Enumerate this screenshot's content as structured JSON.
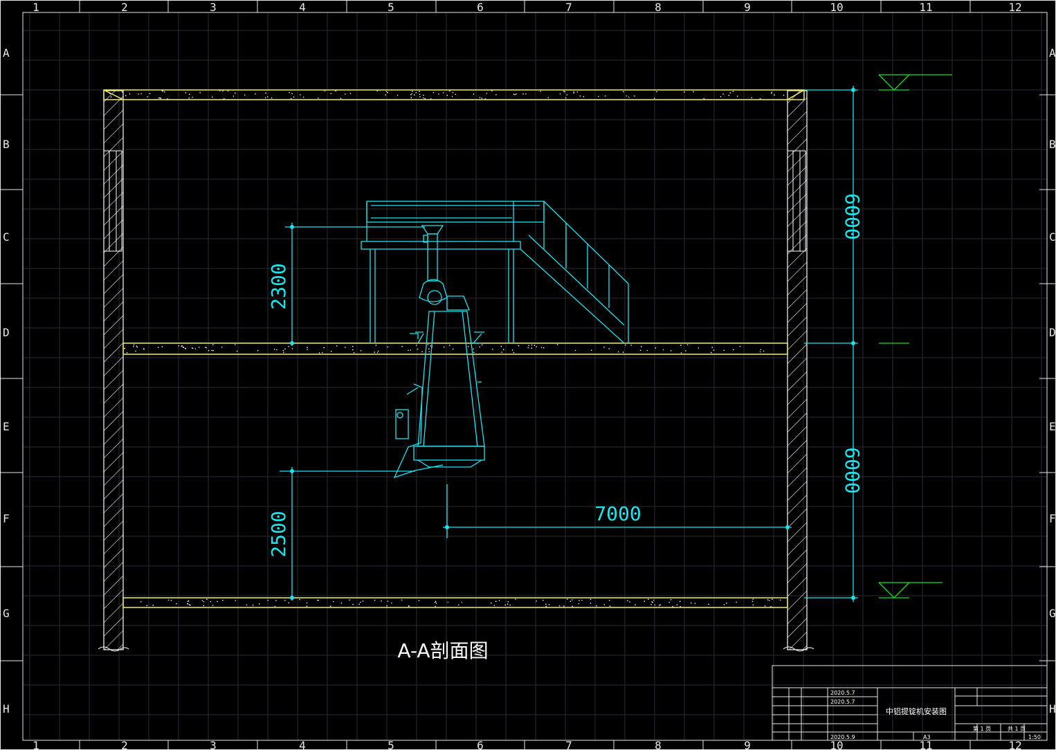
{
  "colors": {
    "background": "#000000",
    "grid": "#2b2b34",
    "frame": "#e8e8e8",
    "equipment": "#19e6ee",
    "slab": "#f5f05a",
    "level_marker": "#18e018"
  },
  "frame": {
    "column_labels": [
      "1",
      "2",
      "3",
      "4",
      "5",
      "6",
      "7",
      "8",
      "9",
      "10",
      "11",
      "12"
    ],
    "row_labels": [
      "A",
      "B",
      "C",
      "D",
      "E",
      "F",
      "G",
      "H"
    ]
  },
  "drawing": {
    "title": "A-A剖面图",
    "dimensions": {
      "platform_height": "2300",
      "discharge_height": "2500",
      "horizontal_offset": "7000",
      "upper_floor_height": "6000",
      "lower_floor_height": "6000"
    }
  },
  "title_block": {
    "drawing_name": "中铝提锭机安装图",
    "dates": [
      "2020.5.7",
      "2020.5.7",
      "2020.5.9"
    ],
    "format": "A3",
    "sheet": "第 1 页",
    "total": "共 1 页",
    "scale": "1:50"
  }
}
